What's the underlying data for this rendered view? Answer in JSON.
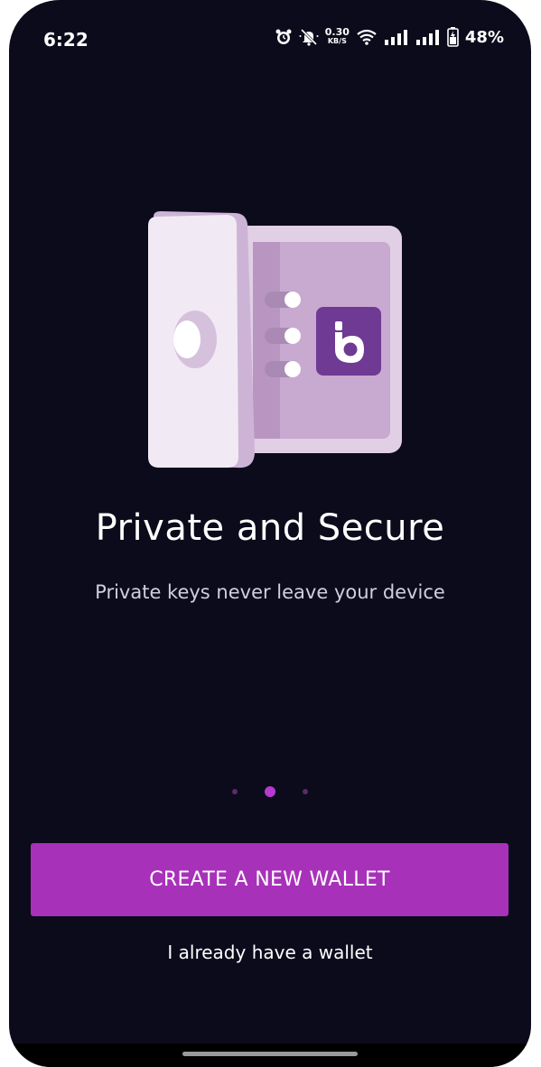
{
  "status_bar": {
    "time": "6:22",
    "net_speed_value": "0.30",
    "net_speed_unit": "KB/S",
    "battery_percent": "48%"
  },
  "onboarding": {
    "title": "Private and Secure",
    "subtitle": "Private keys never leave your device",
    "page_index": 2,
    "page_count": 3
  },
  "actions": {
    "create_wallet_label": "CREATE A NEW WALLET",
    "existing_wallet_label": "I already have a wallet"
  },
  "colors": {
    "background": "#0b0b1c",
    "accent": "#a831ba",
    "active_dot": "#b53ad0",
    "inactive_dot": "#5c2a6b"
  },
  "icons": [
    "alarm-icon",
    "mute-icon",
    "wifi-icon",
    "signal-icon",
    "battery-icon",
    "vault-illustration",
    "brand-logo-icon"
  ]
}
